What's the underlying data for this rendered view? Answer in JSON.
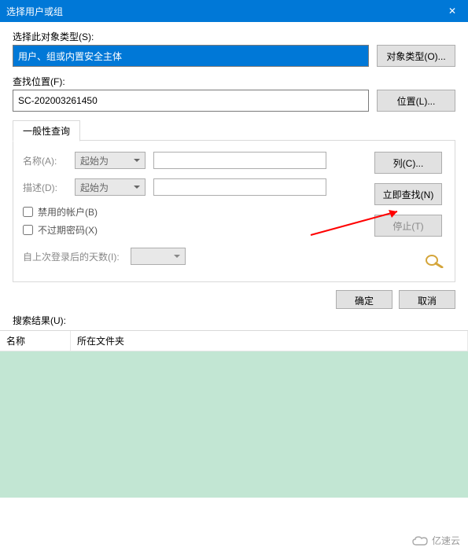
{
  "titlebar": {
    "title": "选择用户或组"
  },
  "objectType": {
    "label": "选择此对象类型(S):",
    "value": "用户、组或内置安全主体",
    "button": "对象类型(O)..."
  },
  "location": {
    "label": "查找位置(F):",
    "value": "SC-202003261450",
    "button": "位置(L)..."
  },
  "tab": {
    "label": "一般性查询"
  },
  "query": {
    "nameLabel": "名称(A):",
    "nameMode": "起始为",
    "descLabel": "描述(D):",
    "descMode": "起始为",
    "disabledAccounts": "禁用的帐户(B)",
    "neverExpirePassword": "不过期密码(X)",
    "daysSinceLastLogon": "自上次登录后的天数(I):"
  },
  "buttons": {
    "columns": "列(C)...",
    "findNow": "立即查找(N)",
    "stop": "停止(T)",
    "ok": "确定",
    "cancel": "取消"
  },
  "results": {
    "label": "搜索结果(U):",
    "colName": "名称",
    "colFolder": "所在文件夹"
  },
  "footer": {
    "brand": "亿速云"
  }
}
